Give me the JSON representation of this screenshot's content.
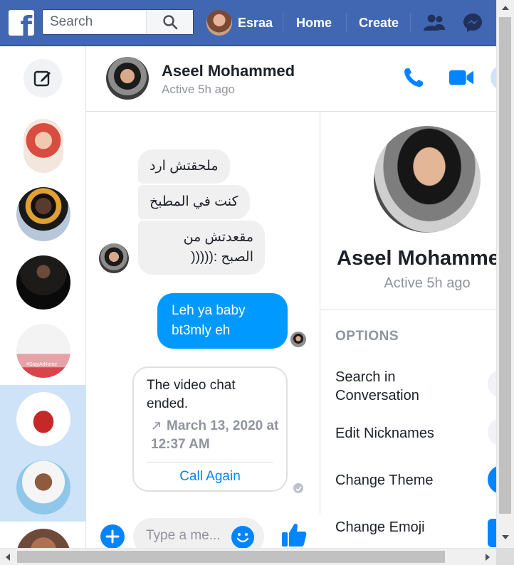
{
  "topbar": {
    "logo": "f",
    "search_placeholder": "Search",
    "user_name": "Esraa",
    "home_label": "Home",
    "create_label": "Create",
    "icons": [
      "facebook-logo-icon",
      "search-icon",
      "friends-icon",
      "messenger-icon"
    ]
  },
  "contacts": {
    "compose_icon": "compose-icon",
    "items": [
      {
        "name": "contact-1",
        "selected": false
      },
      {
        "name": "contact-2",
        "selected": false
      },
      {
        "name": "contact-3",
        "selected": false
      },
      {
        "name": "contact-4",
        "selected": false,
        "badge_text": "#StayAtHome"
      },
      {
        "name": "contact-5",
        "selected": true
      },
      {
        "name": "contact-6",
        "selected": true
      },
      {
        "name": "contact-7",
        "selected": false
      }
    ]
  },
  "conversation": {
    "name": "Aseel Mohammed",
    "status": "Active 5h ago",
    "messages_in": [
      "ملحقتش ارد",
      "كنت في المطبخ",
      "مقعدتش من الصبح :((((("
    ],
    "messages_out": [
      "Leh ya baby bt3mly eh"
    ],
    "video_card": {
      "title": "The video chat ended.",
      "date": "March 13, 2020 at 12:37 AM",
      "action": "Call Again"
    },
    "composer_placeholder": "Type a me..."
  },
  "info_pane": {
    "name": "Aseel Mohammed",
    "status": "Active 5h ago",
    "options_label": "OPTIONS",
    "options": [
      "Search in Conversation",
      "Edit Nicknames",
      "Change Theme",
      "Change Emoji"
    ]
  },
  "colors": {
    "brand": "#4267b2",
    "accent": "#0084ff",
    "outgoing": "#0099ff",
    "selected": "#cfe3f8"
  }
}
